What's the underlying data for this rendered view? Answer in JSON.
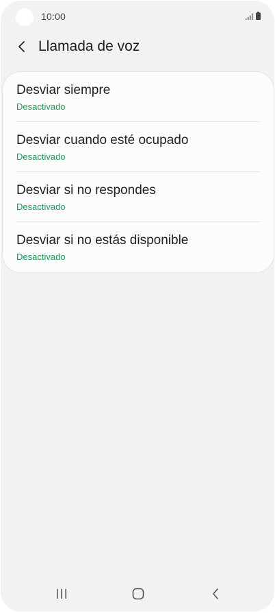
{
  "status_bar": {
    "time": "10:00",
    "icons": [
      "signal-icon",
      "battery-icon"
    ]
  },
  "header": {
    "back_icon": "chevron-left-icon",
    "title": "Llamada de voz"
  },
  "forwarding_options": [
    {
      "title": "Desviar siempre",
      "status": "Desactivado"
    },
    {
      "title": "Desviar cuando esté ocupado",
      "status": "Desactivado"
    },
    {
      "title": "Desviar si no respondes",
      "status": "Desactivado"
    },
    {
      "title": "Desviar si no estás disponible",
      "status": "Desactivado"
    }
  ],
  "nav_bar": {
    "icons": [
      "recent-apps-icon",
      "home-icon",
      "back-icon"
    ]
  },
  "colors": {
    "background": "#f2f2f2",
    "card": "#fcfcfc",
    "status_text": "#1a9a57",
    "title_text": "#222222"
  }
}
